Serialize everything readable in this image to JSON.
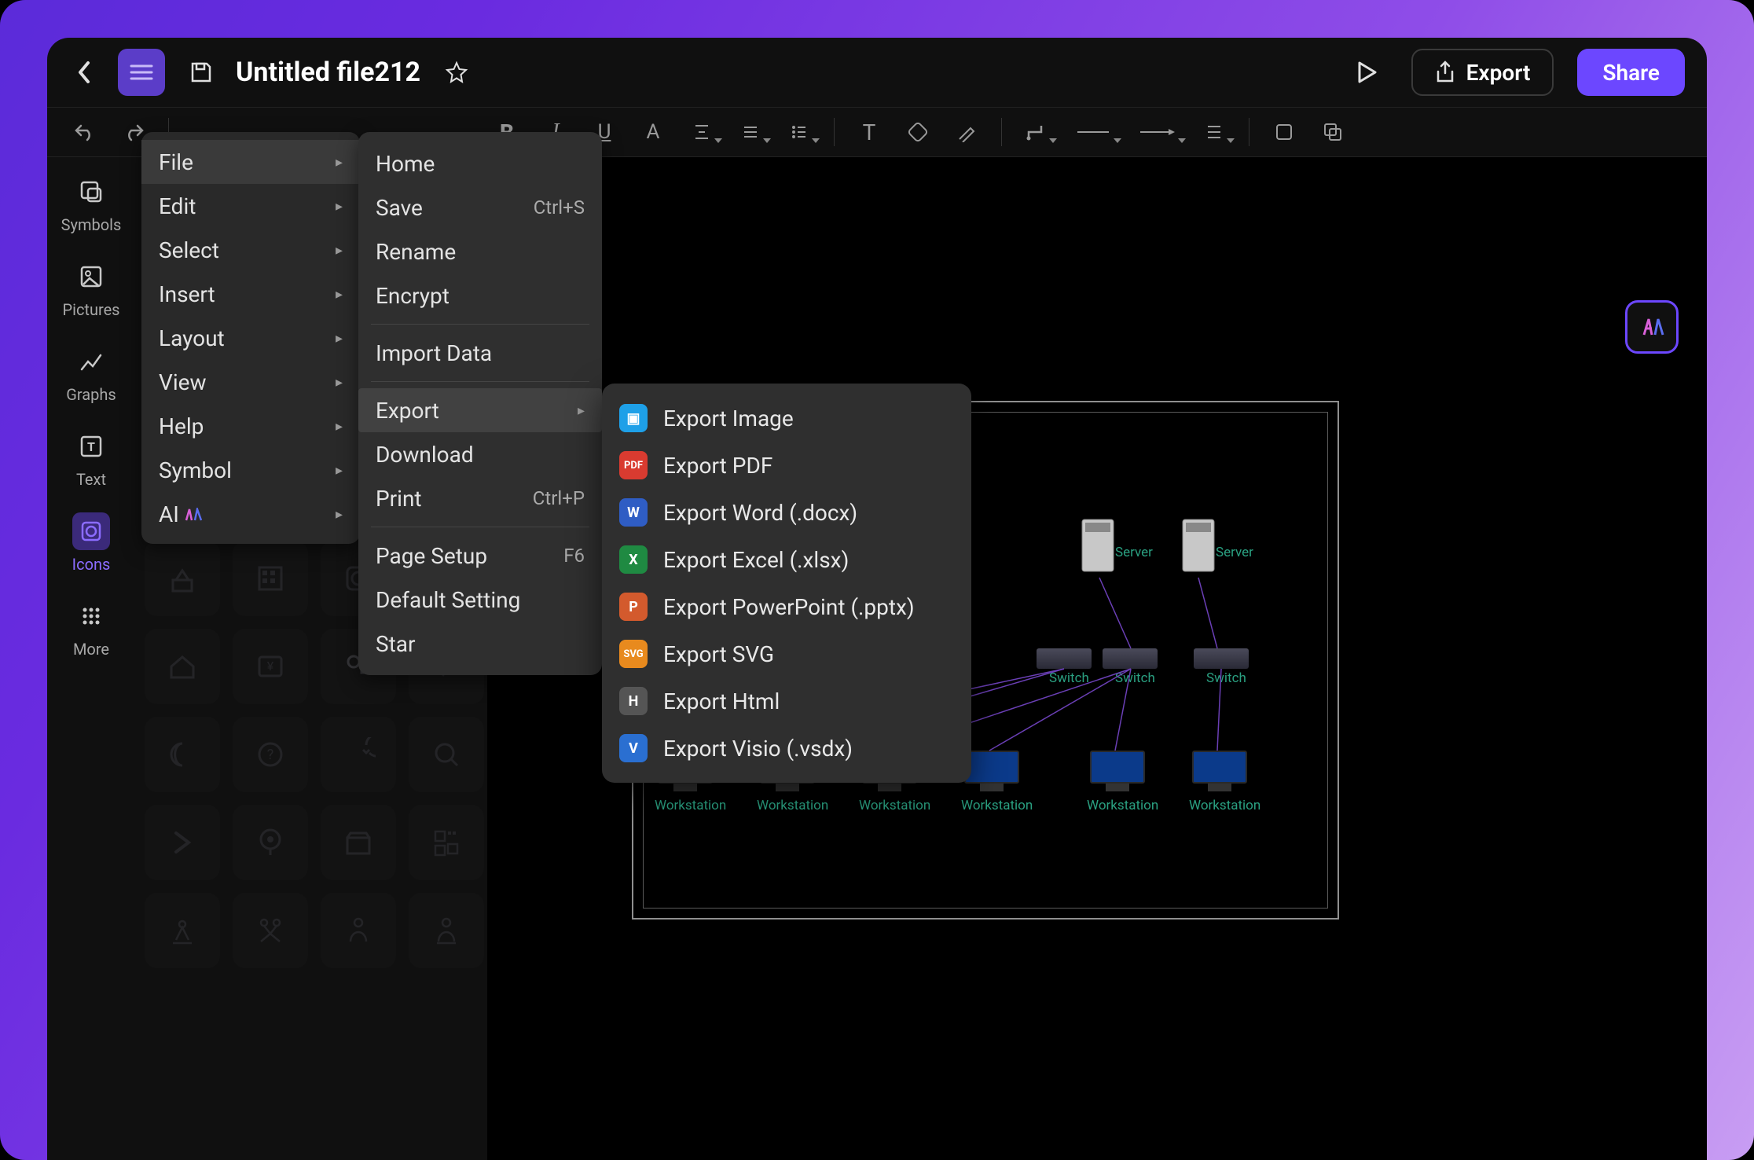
{
  "header": {
    "title": "Untitled file212",
    "export_label": "Export",
    "share_label": "Share"
  },
  "left_rail": {
    "symbols": "Symbols",
    "pictures": "Pictures",
    "graphs": "Graphs",
    "text": "Text",
    "icons": "Icons",
    "more": "More"
  },
  "main_menu": {
    "file": "File",
    "edit": "Edit",
    "select": "Select",
    "insert": "Insert",
    "layout": "Layout",
    "view": "View",
    "help": "Help",
    "symbol": "Symbol",
    "ai": "AI"
  },
  "file_menu": {
    "home": "Home",
    "save": "Save",
    "save_shortcut": "Ctrl+S",
    "rename": "Rename",
    "encrypt": "Encrypt",
    "import_data": "Import Data",
    "export": "Export",
    "download": "Download",
    "print": "Print",
    "print_shortcut": "Ctrl+P",
    "page_setup": "Page Setup",
    "page_setup_shortcut": "F6",
    "default_setting": "Default Setting",
    "star": "Star"
  },
  "export_menu": {
    "image": "Export Image",
    "pdf": "Export PDF",
    "word": "Export Word (.docx)",
    "excel": "Export Excel (.xlsx)",
    "ppt": "Export PowerPoint (.pptx)",
    "svg": "Export SVG",
    "html": "Export Html",
    "visio": "Export Visio (.vsdx)"
  },
  "diagram": {
    "server": "Server",
    "switch": "Switch",
    "workstation": "Workstation"
  }
}
